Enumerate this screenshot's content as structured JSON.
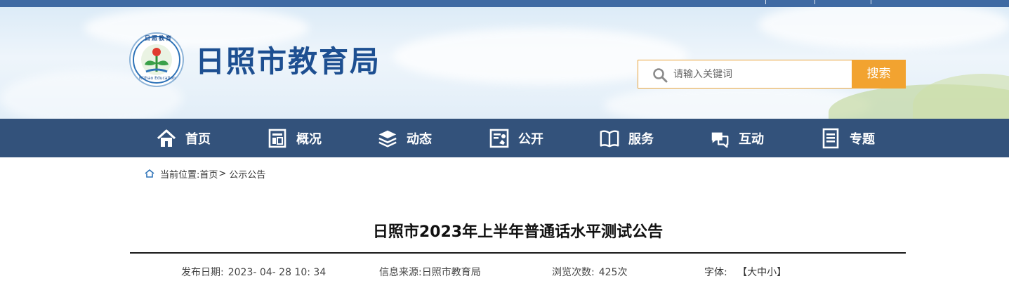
{
  "site": {
    "title": "日照市教育局",
    "logo_text": "日照教育",
    "logo_subtext": "Rizhao Education"
  },
  "search": {
    "placeholder": "请输入关键词",
    "button_label": "搜索"
  },
  "nav": {
    "items": [
      {
        "label": "首页",
        "icon": "home-icon"
      },
      {
        "label": "概况",
        "icon": "overview-icon"
      },
      {
        "label": "动态",
        "icon": "news-stack-icon"
      },
      {
        "label": "公开",
        "icon": "disclosure-icon"
      },
      {
        "label": "服务",
        "icon": "book-icon"
      },
      {
        "label": "互动",
        "icon": "chat-bubbles-icon"
      },
      {
        "label": "专题",
        "icon": "document-icon"
      }
    ]
  },
  "breadcrumb": {
    "prefix": "当前位置:",
    "home": "首页",
    "separator": ">",
    "current": "公示公告"
  },
  "article": {
    "title": "日照市2023年上半年普通话水平测试公告",
    "publish_label": "发布日期:",
    "publish_value": "2023- 04- 28 10: 34",
    "source_label": "信息来源:",
    "source_value": "日照市教育局",
    "views_label": "浏览次数:",
    "views_value": "425次",
    "font_label": "字体:",
    "font_open": "【",
    "font_large": "大",
    "font_medium": "中",
    "font_small": "小",
    "font_close": "】"
  },
  "colors": {
    "topbar": "#3f6aa3",
    "nav_background": "#33527b",
    "title_blue": "#1d4f91",
    "search_button": "#f2a330"
  }
}
